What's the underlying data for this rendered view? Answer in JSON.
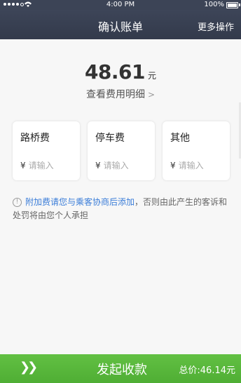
{
  "status": {
    "time": "4:00 PM",
    "battery": "100%"
  },
  "nav": {
    "title": "确认账单",
    "more": "更多操作"
  },
  "summary": {
    "amount": "48.61",
    "unit": "元",
    "detail_link": "查看费用明细"
  },
  "fees": [
    {
      "label": "路桥费",
      "currency": "¥",
      "placeholder": "请输入"
    },
    {
      "label": "停车费",
      "currency": "¥",
      "placeholder": "请输入"
    },
    {
      "label": "其他",
      "currency": "¥",
      "placeholder": "请输入"
    }
  ],
  "notice": {
    "link": "附加费请您与乘客协商后添加",
    "text": "，否则由此产生的客诉和处罚将由您个人承担"
  },
  "footer": {
    "action": "发起收款",
    "total": "总价:46.14元"
  },
  "colors": {
    "nav_bg": "#3c4456",
    "accent_green": "#58b83c",
    "link_blue": "#3b7dd8"
  }
}
